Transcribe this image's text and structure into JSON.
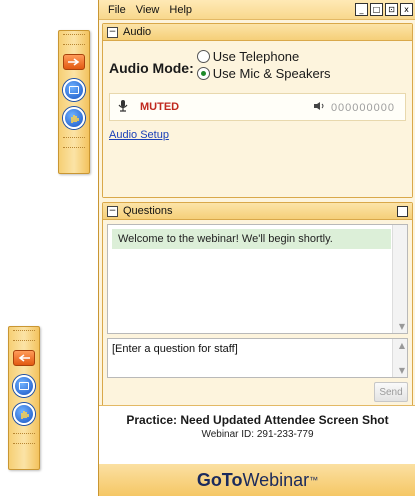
{
  "menu": {
    "file": "File",
    "view": "View",
    "help": "Help"
  },
  "window_controls": {
    "minimize": "_",
    "restore": "□",
    "dock": "⊡",
    "close": "x"
  },
  "audio": {
    "section_title": "Audio",
    "mode_label": "Audio Mode:",
    "option_telephone": "Use Telephone",
    "option_mic": "Use Mic & Speakers",
    "selected_option": "Use Mic & Speakers",
    "mic_status": "MUTED",
    "speaker_level": "000000000",
    "setup_link": "Audio Setup"
  },
  "questions": {
    "section_title": "Questions",
    "messages": [
      "Welcome to the webinar! We'll begin shortly."
    ],
    "input_placeholder": "[Enter a question for staff]",
    "send_label": "Send"
  },
  "footer": {
    "webinar_title": "Practice: Need Updated Attendee Screen Shot",
    "webinar_id": "Webinar ID: 291-233-779",
    "brand_bold": "GoTo",
    "brand_rest": "Webinar",
    "brand_tm": "™"
  },
  "colors": {
    "accent_orange": "#f5c765",
    "muted_red": "#c0281e",
    "link_blue": "#1a3fb8",
    "selected_green": "#1e8a2a"
  },
  "icons": [
    "arrow-icon",
    "screen-icon",
    "raise-hand-icon",
    "microphone-icon",
    "speaker-icon"
  ]
}
